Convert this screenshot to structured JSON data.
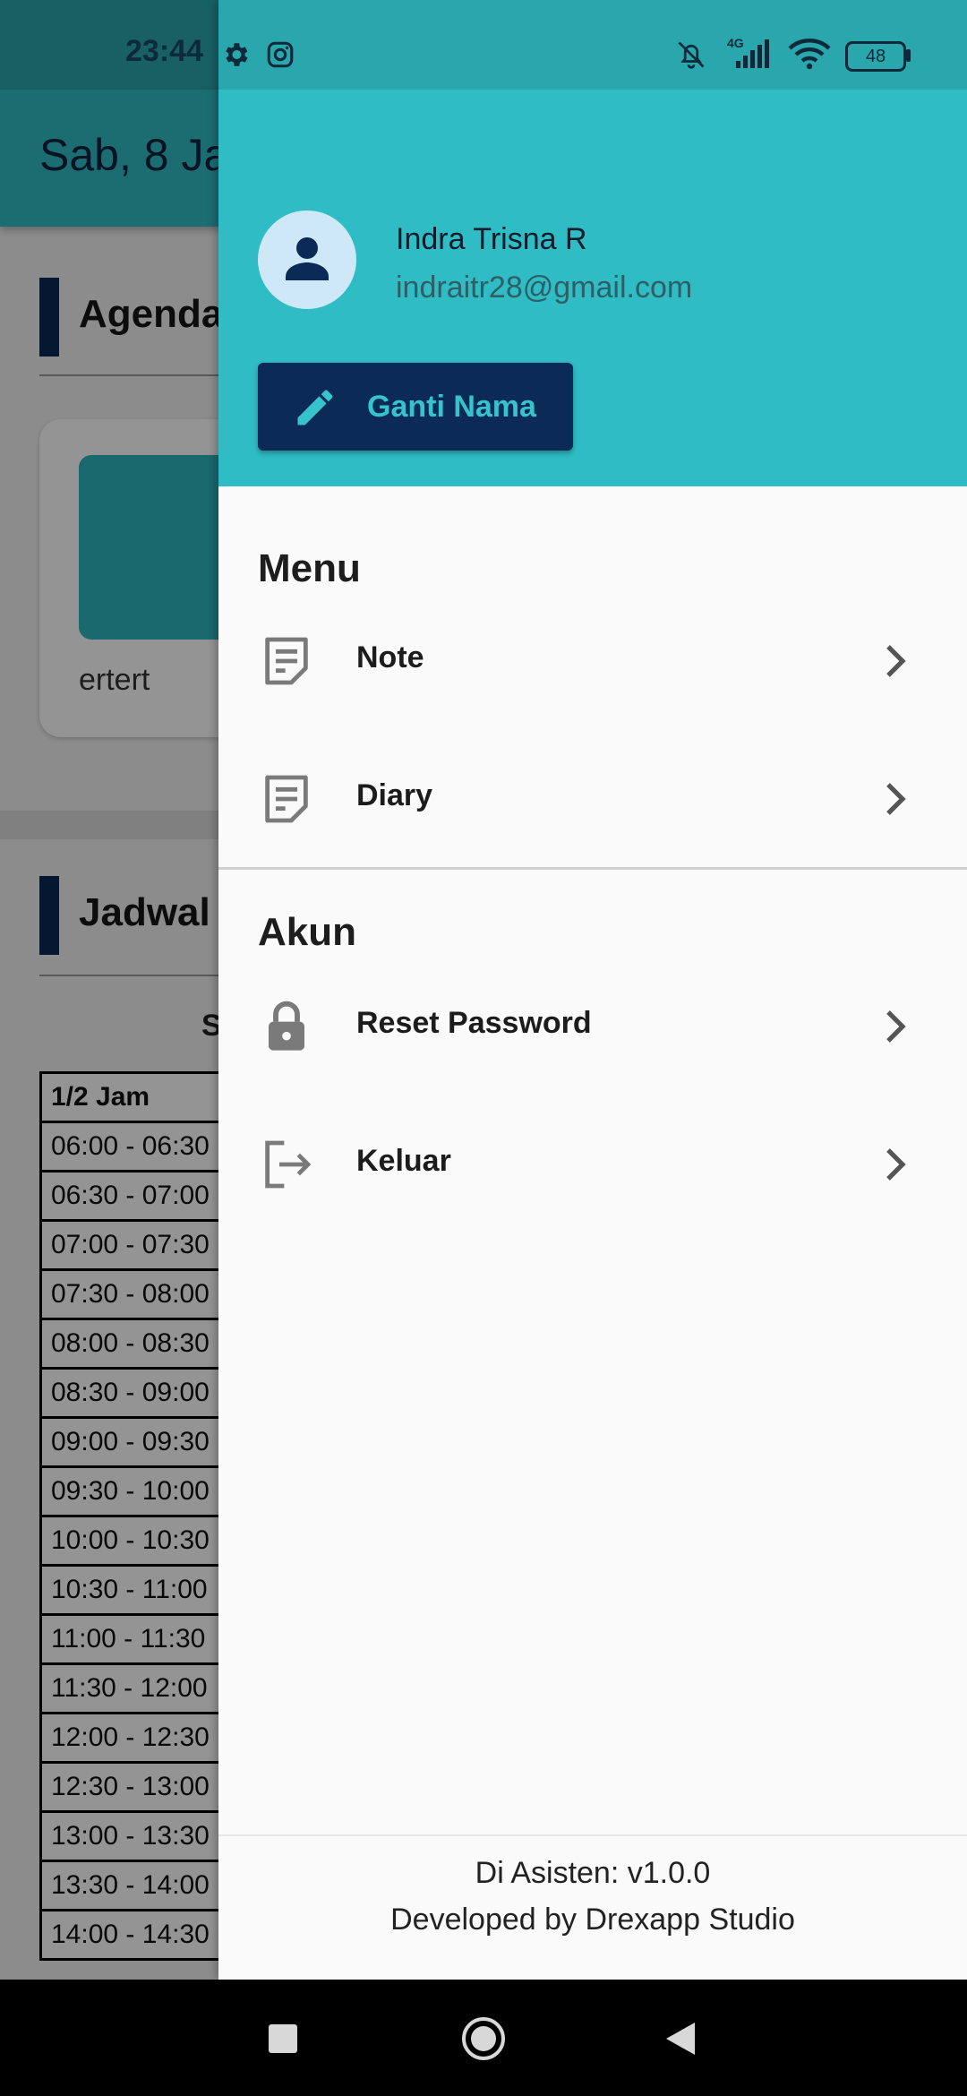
{
  "status_bar": {
    "time": "23:44",
    "network": "4G",
    "battery": "48",
    "icons": [
      "gear-icon",
      "instagram-icon",
      "bell-off-icon",
      "signal-icon",
      "wifi-icon",
      "battery-icon"
    ]
  },
  "background_app": {
    "date": "Sab, 8 Ja",
    "agenda_title": "Agenda",
    "agenda_card_label": "ertert",
    "schedule_title": "Jadwal",
    "day_label": "S",
    "schedule_header": "1/2 Jam",
    "schedule_rows": [
      "06:00 - 06:30",
      "06:30 - 07:00",
      "07:00 - 07:30",
      "07:30 - 08:00",
      "08:00 - 08:30",
      "08:30 - 09:00",
      "09:00 - 09:30",
      "09:30 - 10:00",
      "10:00 - 10:30",
      "10:30 - 11:00",
      "11:00 - 11:30",
      "11:30 - 12:00",
      "12:00 - 12:30",
      "12:30 - 13:00",
      "13:00 - 13:30",
      "13:30 - 14:00",
      "14:00 - 14:30"
    ]
  },
  "drawer": {
    "user": {
      "name": "Indra Trisna R",
      "email": "indraitr28@gmail.com"
    },
    "rename_button": "Ganti Nama",
    "menu_title": "Menu",
    "menu_items": [
      {
        "label": "Note",
        "icon": "note-icon"
      },
      {
        "label": "Diary",
        "icon": "note-icon"
      }
    ],
    "account_title": "Akun",
    "account_items": [
      {
        "label": "Reset Password",
        "icon": "lock-icon"
      },
      {
        "label": "Keluar",
        "icon": "logout-icon"
      }
    ],
    "footer": {
      "version": "Di Asisten: v1.0.0",
      "developer": "Developed by Drexapp Studio"
    }
  },
  "colors": {
    "accent": "#2fbcc4",
    "primary_dark": "#0b2a55",
    "status_bar": "#2aa6ad"
  }
}
